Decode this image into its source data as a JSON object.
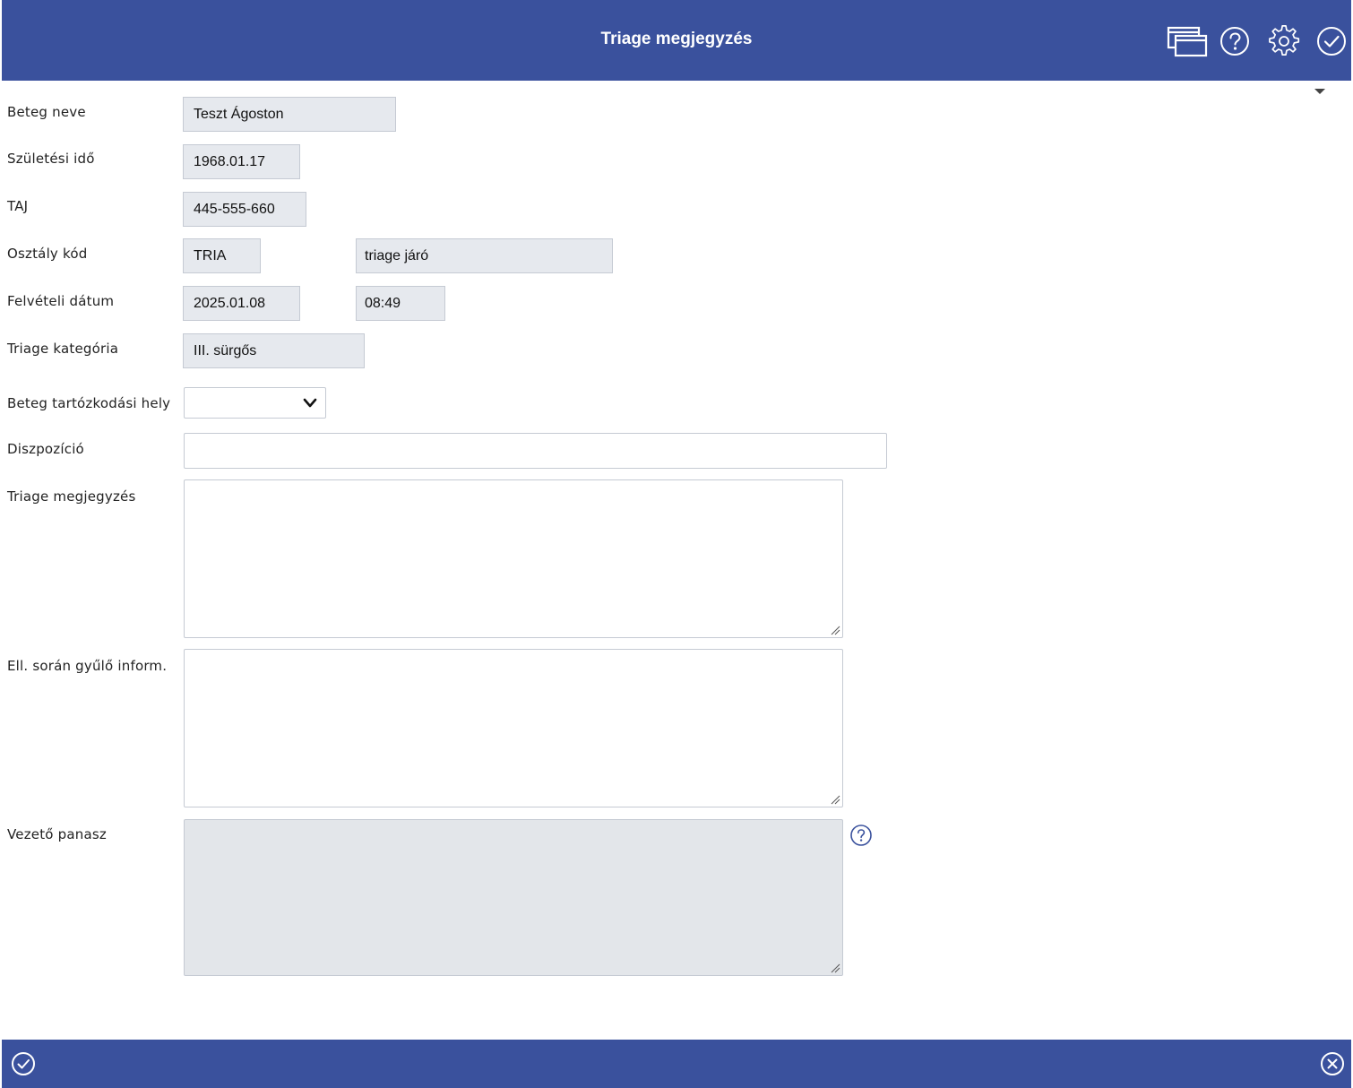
{
  "header": {
    "title": "Triage megjegyzés",
    "icons": [
      "windows-icon",
      "help-icon",
      "gear-icon",
      "check-circle-icon"
    ],
    "background": "#3a519d"
  },
  "form": {
    "patient_name": {
      "label": "Beteg neve",
      "value": "Teszt Ágoston"
    },
    "birth_date": {
      "label": "Születési idő",
      "value": "1968.01.17"
    },
    "taj": {
      "label": "TAJ",
      "value": "445-555-660"
    },
    "department": {
      "label": "Osztály kód",
      "code": "TRIA",
      "name": "triage járó"
    },
    "admission": {
      "label": "Felvételi dátum",
      "date": "2025.01.08",
      "time": "08:49"
    },
    "triage_category": {
      "label": "Triage kategória",
      "value": "III. sürgős"
    },
    "location": {
      "label": "Beteg tartózkodási hely",
      "value": ""
    },
    "disposition": {
      "label": "Diszpozíció",
      "value": ""
    },
    "triage_note": {
      "label": "Triage megjegyzés",
      "value": ""
    },
    "collected_info": {
      "label": "Ell. során gyűlő inform.",
      "value": ""
    },
    "chief_complaint": {
      "label": "Vezető panasz",
      "value": ""
    }
  },
  "footer": {
    "icons": [
      "ok-circle-icon",
      "cancel-circle-icon"
    ]
  }
}
